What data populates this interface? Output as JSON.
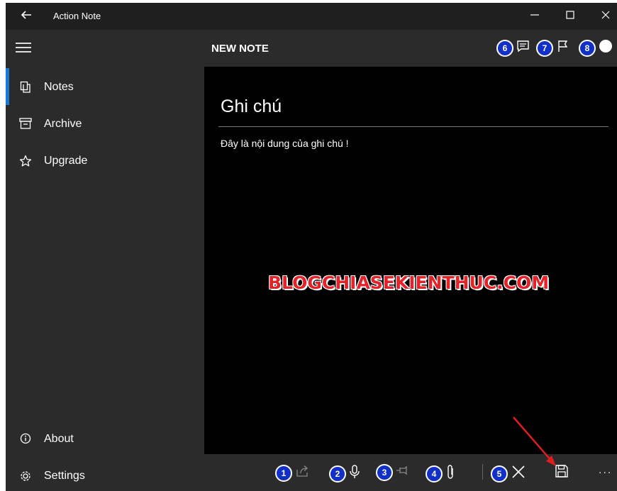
{
  "window": {
    "app_title": "Action Note",
    "back_icon": "back-arrow-icon",
    "controls": [
      "minimize-icon",
      "maximize-icon",
      "close-icon"
    ]
  },
  "sidebar": {
    "menu_icon": "hamburger-icon",
    "items": [
      {
        "label": "Notes",
        "icon": "notes-icon",
        "active": true
      },
      {
        "label": "Archive",
        "icon": "archive-icon",
        "active": false
      },
      {
        "label": "Upgrade",
        "icon": "star-icon",
        "active": false
      }
    ],
    "footer_items": [
      {
        "label": "About",
        "icon": "info-icon"
      },
      {
        "label": "Settings",
        "icon": "gear-icon"
      }
    ]
  },
  "header": {
    "title": "NEW NOTE",
    "actions": [
      {
        "badge": "6",
        "icon": "note-details-icon"
      },
      {
        "badge": "7",
        "icon": "flag-icon"
      },
      {
        "badge": "8",
        "icon": "color-circle-icon"
      }
    ]
  },
  "note": {
    "title": "Ghi chú",
    "body": "Đây là nội dung của ghi chú !"
  },
  "watermark": "BLOGCHIASEKIENTHUC.COM",
  "bottom_bar": {
    "actions": [
      {
        "badge": "1",
        "icon": "share-icon"
      },
      {
        "badge": "2",
        "icon": "microphone-icon"
      },
      {
        "badge": "3",
        "icon": "pin-icon"
      },
      {
        "badge": "4",
        "icon": "attachment-icon"
      },
      {
        "badge": "5",
        "icon": "close-x-icon"
      }
    ],
    "save_icon": "save-icon",
    "more_label": "..."
  },
  "colors": {
    "accent": "#1a78d8",
    "badge": "#1030c8",
    "watermark": "#e2232a",
    "annotation_arrow": "#e01e1e"
  }
}
